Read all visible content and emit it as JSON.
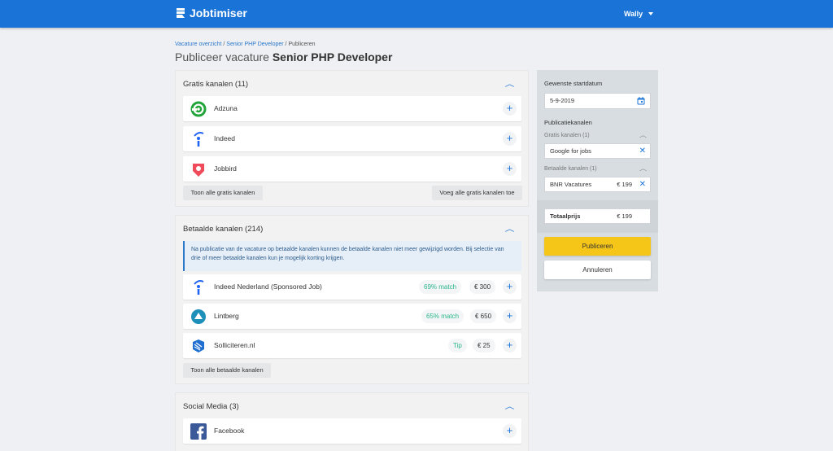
{
  "brand": {
    "name": "Jobtimiser"
  },
  "user": {
    "name": "Wally"
  },
  "breadcrumb": {
    "link1": "Vacature overzicht",
    "sep1": " / ",
    "link2": "Senior PHP Developer",
    "sep2": " / ",
    "current": "Publiceren"
  },
  "page": {
    "title_prefix": "Publiceer vacature ",
    "title_job": "Senior PHP Developer"
  },
  "free": {
    "title": "Gratis kanalen (11)",
    "items": [
      {
        "name": "Adzuna"
      },
      {
        "name": "Indeed"
      },
      {
        "name": "Jobbird"
      }
    ],
    "show_all": "Toon alle gratis kanalen",
    "add_all": "Voeg alle gratis kanalen toe"
  },
  "paid": {
    "title": "Betaalde kanalen (214)",
    "info": "Na publicatie van de vacature op betaalde kanalen kunnen de betaalde kanalen niet meer gewijzigd worden. Bij selectie van drie of meer betaalde kanalen kun je mogelijk korting krijgen.",
    "items": [
      {
        "name": "Indeed Nederland (Sponsored Job)",
        "match": "69% match",
        "price": "€ 300"
      },
      {
        "name": "Lintberg",
        "match": "65% match",
        "price": "€ 650"
      },
      {
        "name": "Solliciteren.nl",
        "match": "Tip",
        "price": "€ 25"
      }
    ],
    "show_all": "Toon alle betaalde kanalen"
  },
  "social": {
    "title": "Social Media (3)",
    "items": [
      {
        "name": "Facebook"
      }
    ]
  },
  "sidebar": {
    "start_label": "Gewenste startdatum",
    "start_value": "5-9-2019",
    "channels_label": "Publicatiekanalen",
    "free_label": "Gratis kanalen (1)",
    "free_item": "Google for jobs",
    "paid_label": "Betaalde kanalen (1)",
    "paid_item": "BNR Vacatures",
    "paid_item_price": "€ 199",
    "total_label": "Totaalprijs",
    "total_value": "€ 199",
    "publish": "Publiceren",
    "cancel": "Annuleren"
  },
  "colors": {
    "primary": "#1a73d6",
    "accent": "#f5c518",
    "match": "#2bb58c"
  }
}
